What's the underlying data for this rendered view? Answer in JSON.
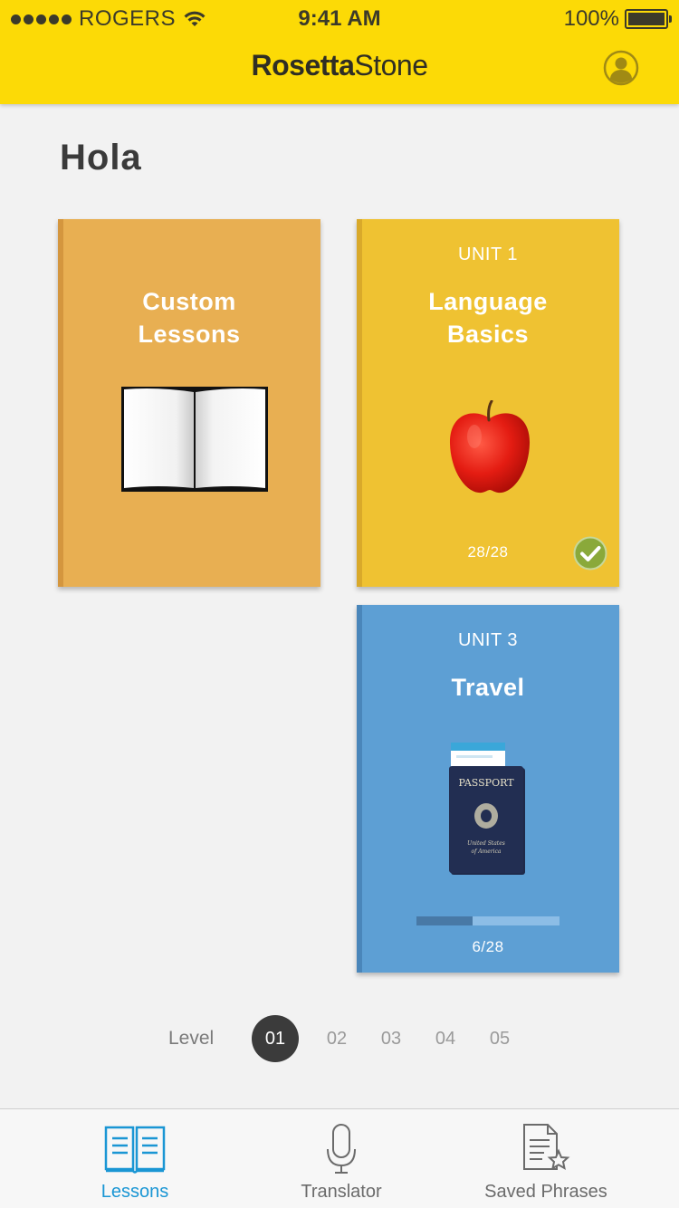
{
  "status_bar": {
    "carrier": "ROGERS",
    "time": "9:41 AM",
    "battery": "100%"
  },
  "header": {
    "brand_bold": "Rosetta",
    "brand_light": "Stone",
    "profile_icon": "user-circle-icon"
  },
  "greeting": "Hola",
  "cards": {
    "custom": {
      "title_line1": "Custom",
      "title_line2": "Lessons",
      "icon": "open-book"
    },
    "unit1": {
      "unit": "UNIT 1",
      "title_line1": "Language",
      "title_line2": "Basics",
      "count": "28/28",
      "completed": true,
      "icon": "apple",
      "check_color": "#8aa93a"
    },
    "unit3": {
      "unit": "UNIT 3",
      "title": "Travel",
      "count": "6/28",
      "progress": 0.39,
      "icon": "passport"
    }
  },
  "levels": {
    "label": "Level",
    "items": [
      "01",
      "02",
      "03",
      "04",
      "05"
    ],
    "selected": "01"
  },
  "tabbar": {
    "items": [
      {
        "label": "Lessons",
        "icon": "book-icon",
        "active": true
      },
      {
        "label": "Translator",
        "icon": "microphone-icon",
        "active": false
      },
      {
        "label": "Saved Phrases",
        "icon": "saved-document-star-icon",
        "active": false
      }
    ]
  },
  "colors": {
    "header": "#fcda06",
    "custom_card": "#e8af52",
    "unit1_card": "#efc232",
    "unit3_card": "#5d9fd4",
    "accent_blue": "#1a96d4"
  }
}
